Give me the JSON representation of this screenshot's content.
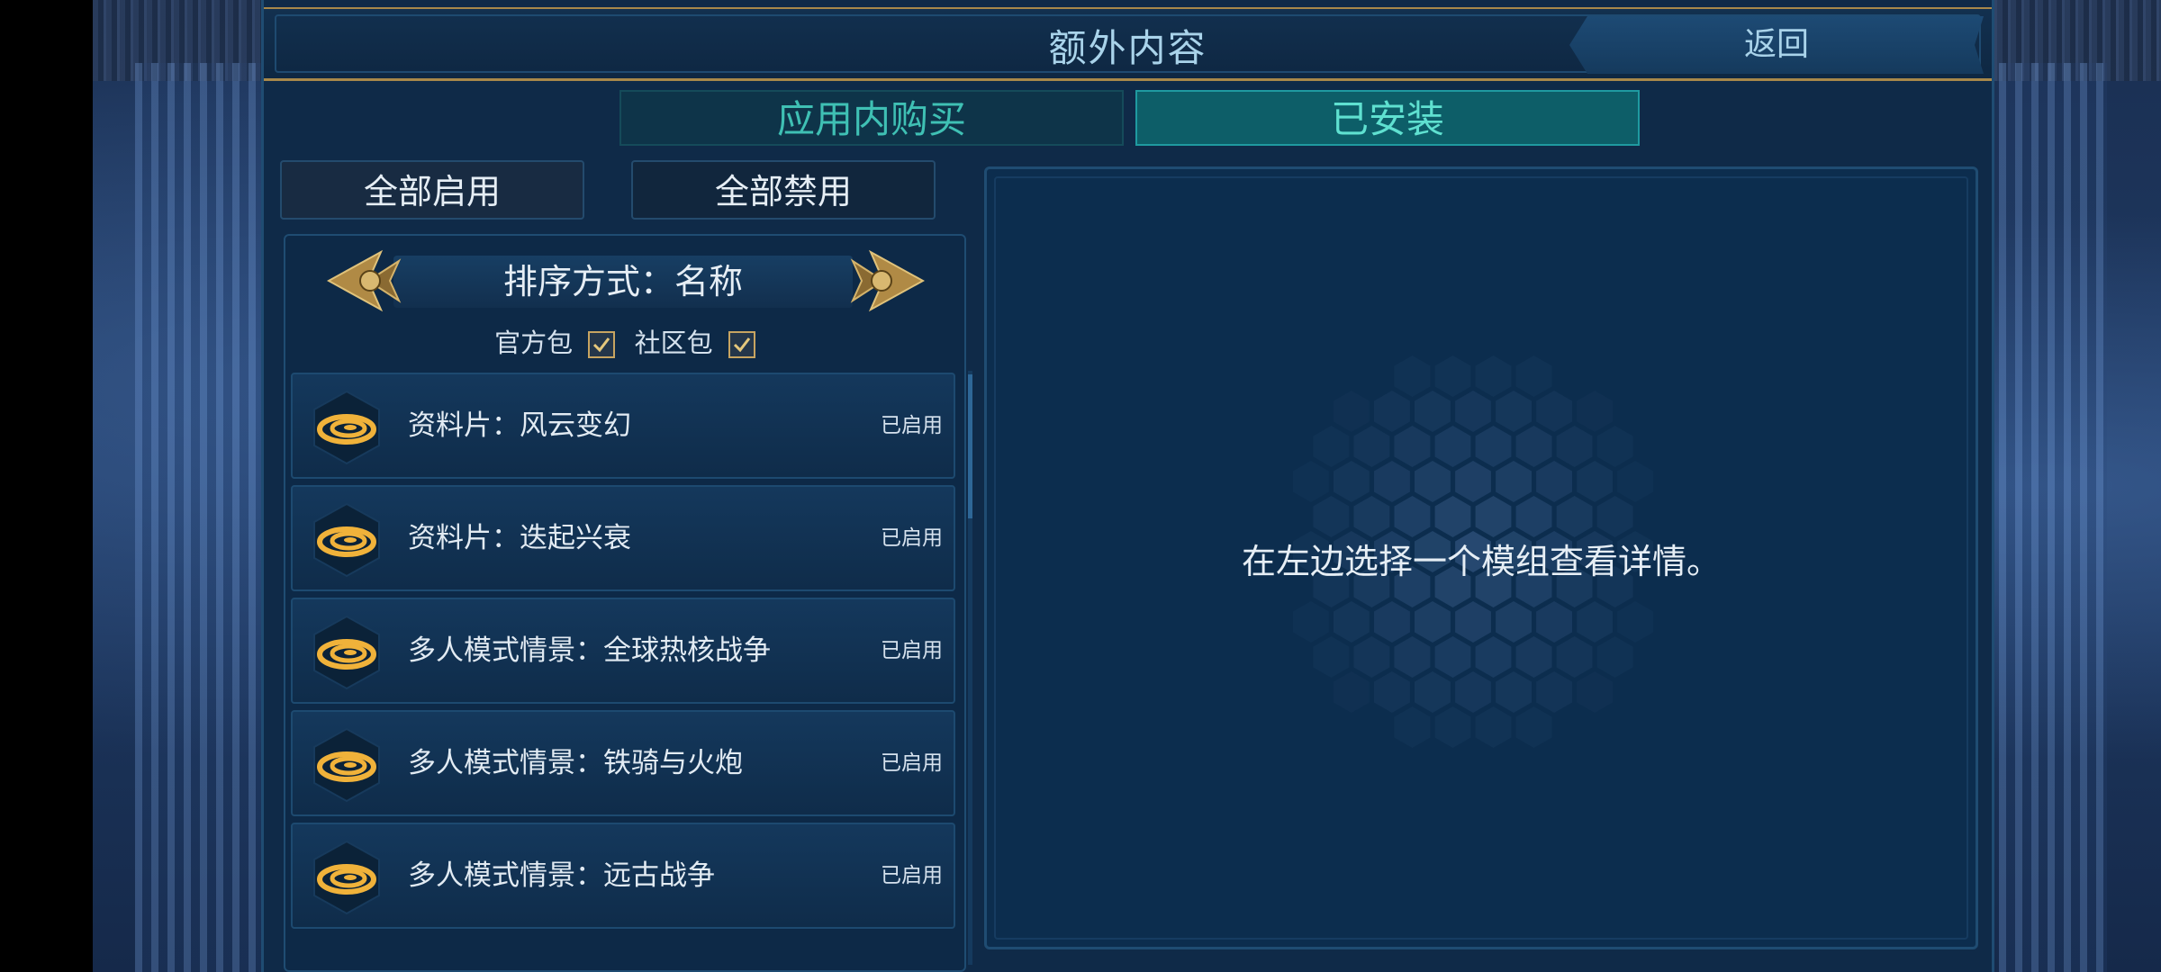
{
  "header": {
    "title": "额外内容",
    "back_label": "返回"
  },
  "tabs": [
    {
      "label": "应用内购买",
      "active": false
    },
    {
      "label": "已安装",
      "active": true
    }
  ],
  "actions": {
    "enable_all": "全部启用",
    "disable_all": "全部禁用"
  },
  "sort": {
    "label": "排序方式：名称"
  },
  "filters": [
    {
      "label": "官方包",
      "checked": true
    },
    {
      "label": "社区包",
      "checked": true
    }
  ],
  "mods": [
    {
      "name": "资料片：风云变幻",
      "status": "已启用",
      "icon": "expansion-swirl-icon"
    },
    {
      "name": "资料片：迭起兴衰",
      "status": "已启用",
      "icon": "expansion-swirl-icon"
    },
    {
      "name": "多人模式情景：全球热核战争",
      "status": "已启用",
      "icon": "expansion-swirl-icon"
    },
    {
      "name": "多人模式情景：铁骑与火炮",
      "status": "已启用",
      "icon": "expansion-swirl-icon"
    },
    {
      "name": "多人模式情景：远古战争",
      "status": "已启用",
      "icon": "expansion-swirl-icon"
    }
  ],
  "details": {
    "hint": "在左边选择一个模组查看详情。"
  },
  "colors": {
    "panel_bg": "#0f2a48",
    "gold_trim": "#a8884a",
    "tab_active": "#0d5e68",
    "tab_text": "#3fc0b4",
    "swirl_icon": "#f0b23a"
  }
}
